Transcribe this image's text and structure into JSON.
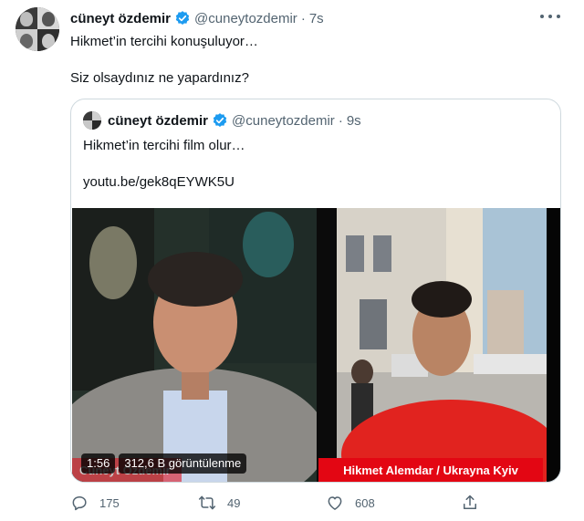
{
  "tweet": {
    "author": {
      "display_name": "cüneyt özdemir",
      "handle": "@cuneytozdemir",
      "time": "7s"
    },
    "text_line1": "Hikmet’in tercihi konuşuluyor…",
    "text_line2": "Siz olsaydınız ne yapardınız?",
    "quoted": {
      "author": {
        "display_name": "cüneyt özdemir",
        "handle": "@cuneytozdemir",
        "time": "9s"
      },
      "text_line1": "Hikmet’in tercihi film olur…",
      "link": "youtu.be/gek8qEYWK5U",
      "video": {
        "left_label": "Cüneyt Özdemir",
        "right_label": "Hikmet Alemdar / Ukrayna Kyiv",
        "duration": "1:56",
        "views": "312,6 B görüntülenme"
      }
    },
    "actions": {
      "replies": "175",
      "retweets": "49",
      "likes": "608"
    }
  },
  "colors": {
    "text": "#0f1419",
    "secondary": "#536471",
    "verified": "#1d9bf0",
    "border": "#cfd9de",
    "label_red": "#e30613"
  },
  "icons": [
    "verified-badge-icon",
    "more-icon",
    "reply-icon",
    "retweet-icon",
    "like-icon",
    "share-icon"
  ]
}
